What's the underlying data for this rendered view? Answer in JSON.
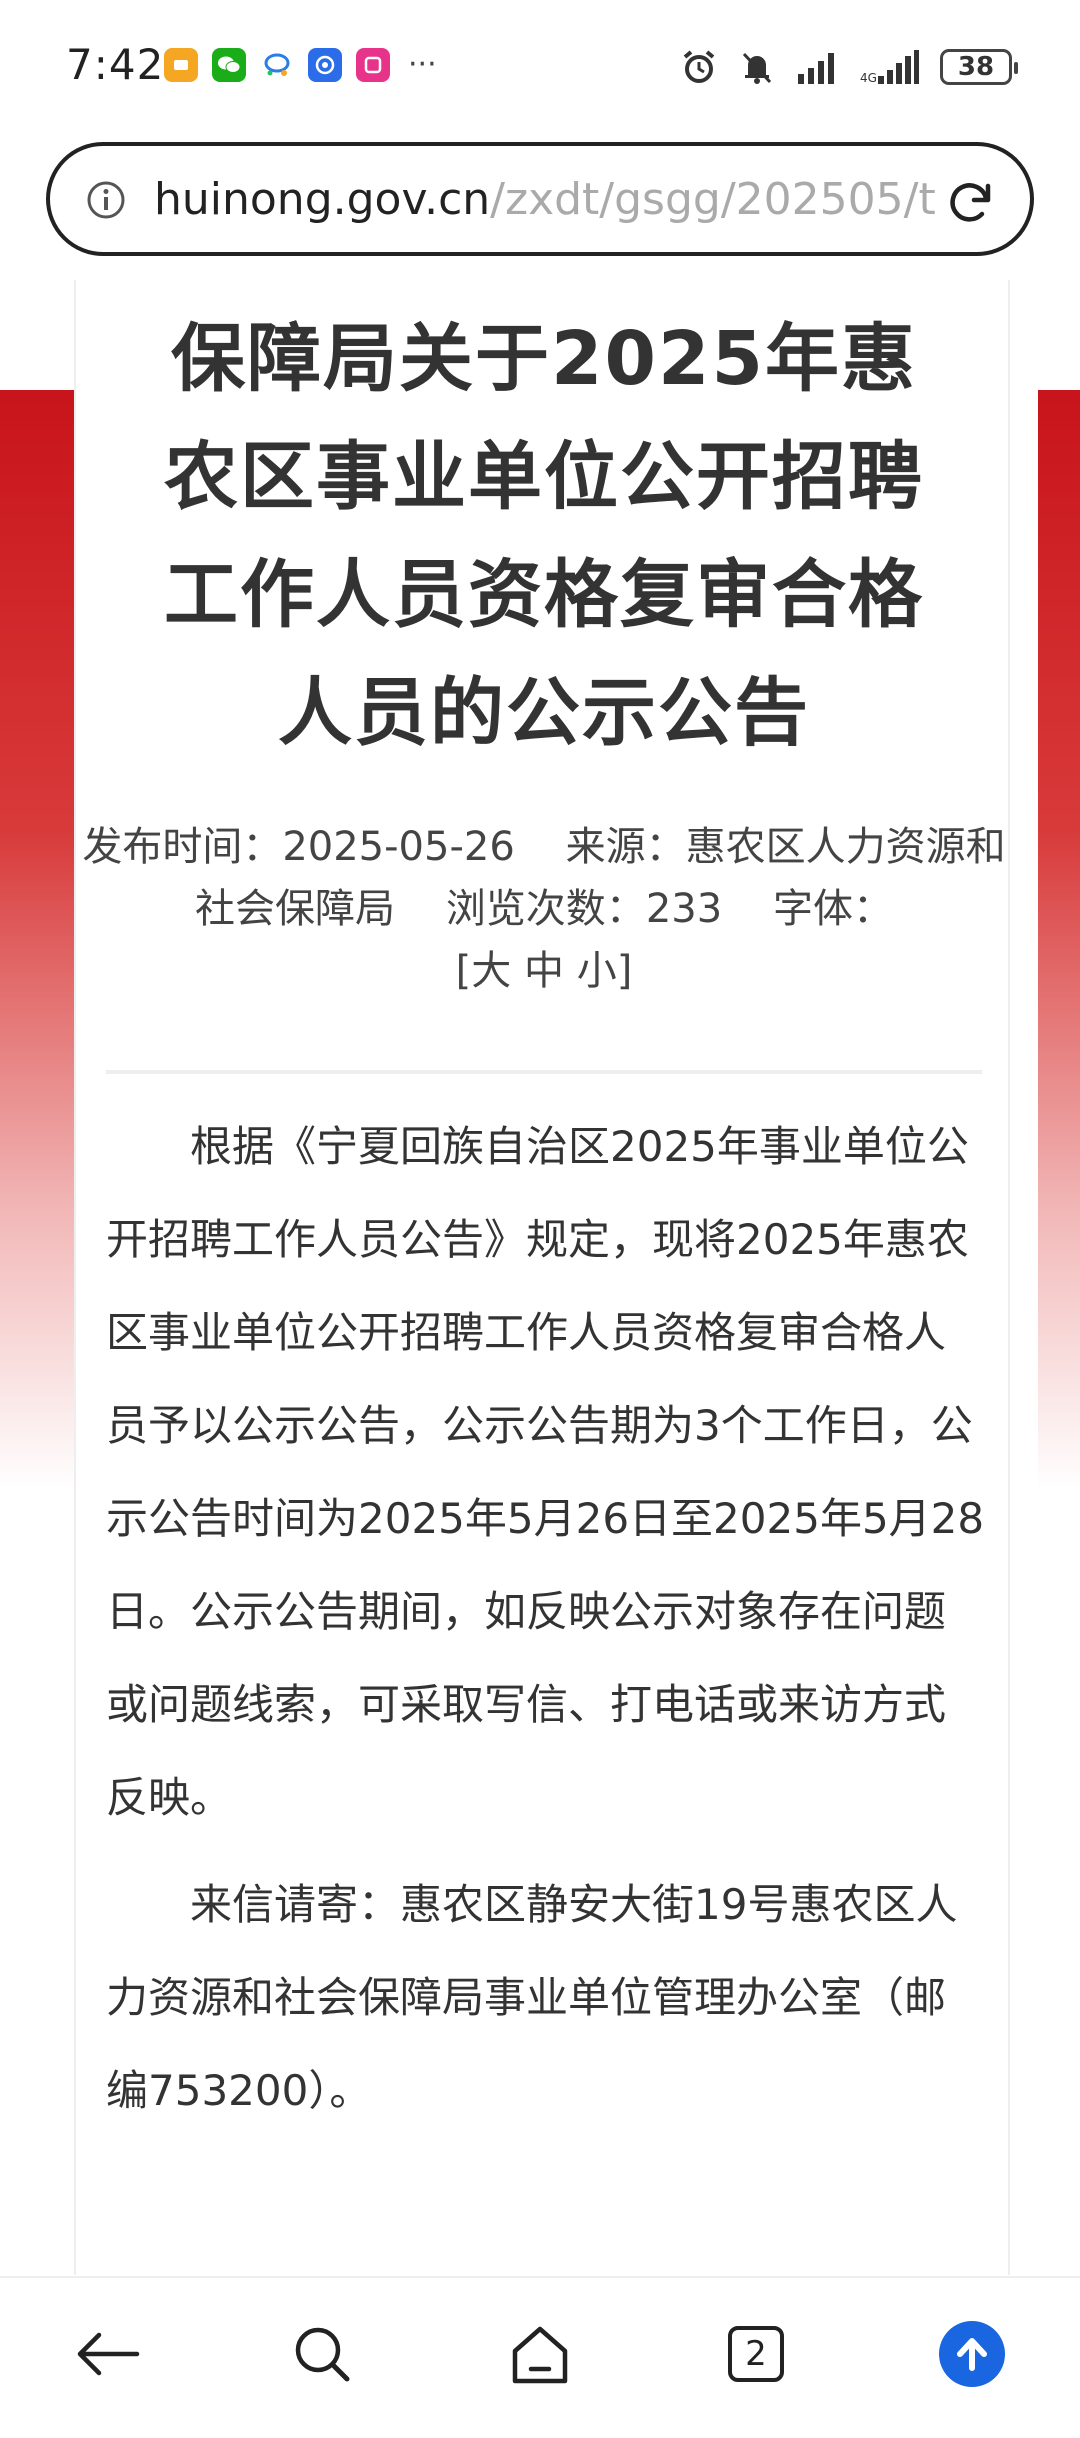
{
  "status_bar": {
    "time": "7:42",
    "app_icons": [
      "notes-app-icon",
      "wechat-icon",
      "chat-bubble-icon",
      "blue-app-icon",
      "pink-app-icon"
    ],
    "more": "···",
    "battery": "38"
  },
  "address_bar": {
    "url_host": "huinong.gov.cn",
    "url_path": "/zxdt/gsgg/202505/t"
  },
  "article": {
    "title_lines": [
      "保障局关于2025年惠",
      "农区事业单位公开招聘",
      "工作人员资格复审合格",
      "人员的公示公告"
    ],
    "meta": {
      "publish_label": "发布时间：",
      "publish_date": "2025-05-26",
      "source_label": "来源：",
      "source_value": "惠农区人力资源和社会保障局",
      "views_label": "浏览次数：",
      "views_value": "233",
      "font_label": "字体：",
      "font_sizes": "[大 中 小]"
    },
    "paragraphs": [
      "根据《宁夏回族自治区2025年事业单位公开招聘工作人员公告》规定，现将2025年惠农区事业单位公开招聘工作人员资格复审合格人员予以公示公告，公示公告期为3个工作日，公示公告时间为2025年5月26日至2025年5月28日。公示公告期间，如反映公示对象存在问题或问题线索，可采取写信、打电话或来访方式反映。",
      "来信请寄：惠农区静安大街19号惠农区人力资源和社会保障局事业单位管理办公室（邮编753200）。"
    ]
  },
  "bottom_nav": {
    "tab_count": "2"
  },
  "colors": {
    "banner_red": "#c8141b",
    "up_button": "#1a66e0",
    "url_path_gray": "#aaaaaa"
  }
}
